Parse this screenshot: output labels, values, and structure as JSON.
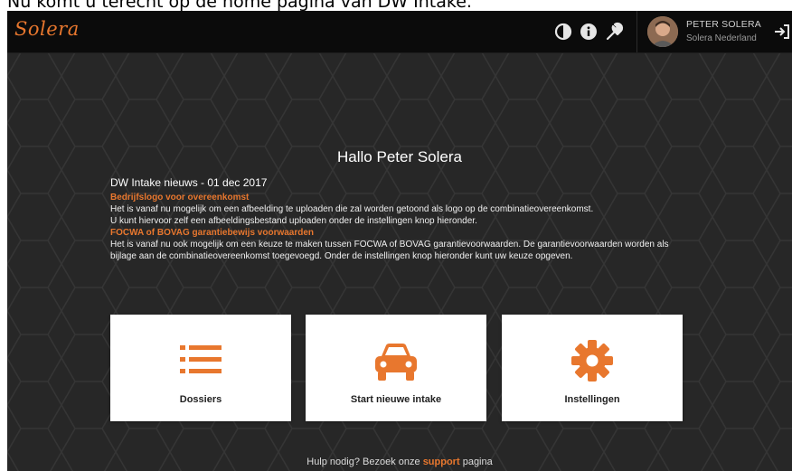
{
  "caption": "Nu komt u terecht op de home pagina van DW Intake.",
  "header": {
    "logo": "Solera",
    "icons": [
      "contrast-icon",
      "info-icon",
      "wrench-icon",
      "logout-icon"
    ],
    "user": {
      "name": "PETER SOLERA",
      "org": "Solera Nederland"
    }
  },
  "main": {
    "greeting": "Hallo Peter Solera",
    "news_title": "DW Intake nieuws - 01 dec 2017",
    "items": [
      {
        "heading": "Bedrijfslogo voor overeenkomst",
        "body": "Het is vanaf nu mogelijk om een afbeelding te uploaden die zal worden getoond als logo op de combinatieovereenkomst.",
        "body2": "U kunt hiervoor zelf een afbeeldingsbestand uploaden onder de instellingen knop hieronder."
      },
      {
        "heading": "FOCWA of BOVAG garantiebewijs voorwaarden",
        "body": "Het is vanaf nu ook mogelijk om een keuze te maken tussen FOCWA of BOVAG garantievoorwaarden. De garantievoorwaarden worden als bijlage aan de combinatieovereenkomst toegevoegd. Onder de instellingen knop hieronder kunt uw keuze opgeven."
      }
    ],
    "cards": [
      {
        "label": "Dossiers",
        "icon": "list-icon"
      },
      {
        "label": "Start nieuwe intake",
        "icon": "car-icon"
      },
      {
        "label": "Instellingen",
        "icon": "gear-icon"
      }
    ],
    "help": {
      "prefix": "Hulp nodig? Bezoek onze",
      "link": "support",
      "suffix": "pagina"
    }
  },
  "colors": {
    "accent": "#e8772e",
    "background": "#2a2a2a",
    "topbar": "#0b0b0b"
  }
}
